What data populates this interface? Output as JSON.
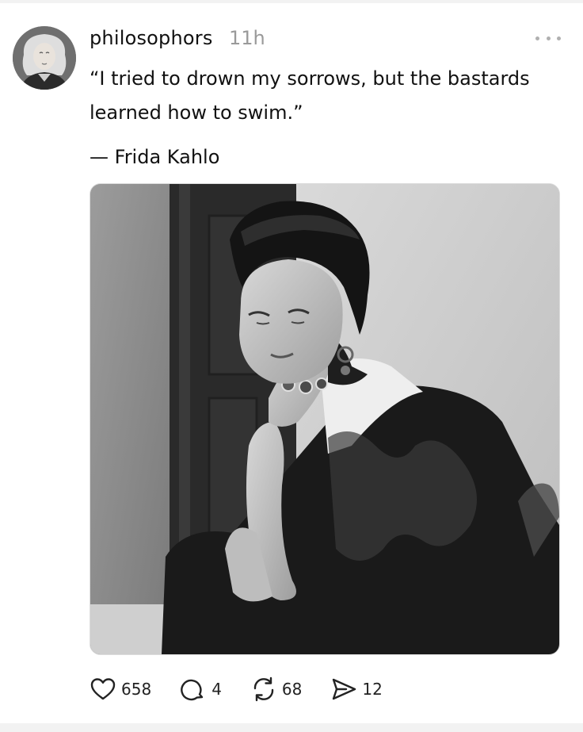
{
  "post": {
    "username": "philosophors",
    "time": "11h",
    "quote": "“I tried to drown my sorrows, but the bastards learned how to swim.”",
    "author": "— Frida Kahlo",
    "more_icon": "ellipsis-icon",
    "avatar_icon": "profile-avatar"
  },
  "actions": {
    "like_count": "658",
    "reply_count": "4",
    "repost_count": "68",
    "share_count": "12"
  }
}
